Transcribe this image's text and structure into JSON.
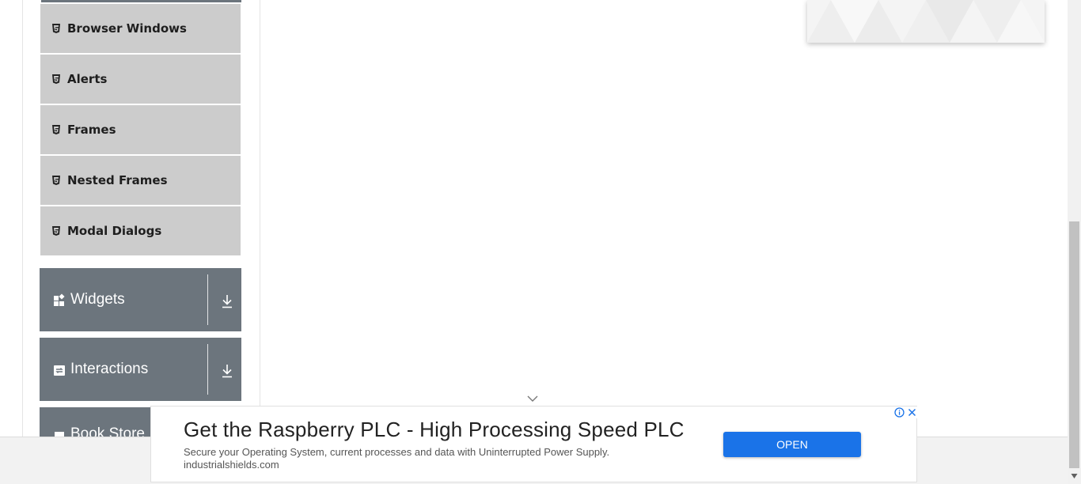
{
  "sidebar": {
    "submenu_items": [
      {
        "label": "Browser Windows",
        "icon": "html5-icon"
      },
      {
        "label": "Alerts",
        "icon": "html5-icon"
      },
      {
        "label": "Frames",
        "icon": "html5-icon"
      },
      {
        "label": "Nested Frames",
        "icon": "html5-icon"
      },
      {
        "label": "Modal Dialogs",
        "icon": "html5-icon"
      }
    ],
    "groups": [
      {
        "label": "Widgets",
        "icon": "widgets-icon",
        "toggle_icon": "download-arrow-icon"
      },
      {
        "label": "Interactions",
        "icon": "interactions-icon",
        "toggle_icon": "download-arrow-icon"
      },
      {
        "label": "Book Store",
        "icon": "book-store-icon"
      }
    ]
  },
  "ad_banner": {
    "headline": "Get the Raspberry PLC - High Processing Speed PLC",
    "description": "Secure your Operating System, current processes and data with Uninterrupted Power Supply.",
    "domain": "industrialshields.com",
    "cta_label": "OPEN",
    "info_icon": "info-icon",
    "close_icon": "close-icon"
  },
  "colors": {
    "sidebar_item_bg": "#cccccc",
    "group_header_bg": "#6c757d",
    "cta_blue": "#1a73e8"
  }
}
